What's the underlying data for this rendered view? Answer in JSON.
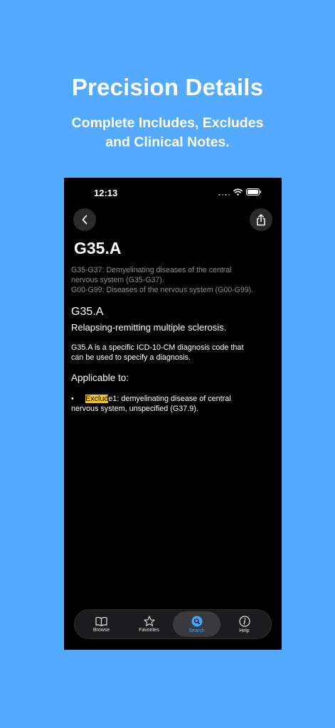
{
  "promo": {
    "title": "Precision Details",
    "subtitle_line1": "Complete Includes, Excludes",
    "subtitle_line2": "and Clinical Notes."
  },
  "status_bar": {
    "time": "12:13"
  },
  "header": {
    "back_icon": "chevron-left-icon",
    "share_icon": "share-icon"
  },
  "code": {
    "title": "G35.A",
    "hierarchy": [
      "G35-G37: Demyelinating diseases of the central",
      "nervous system (G35-G37).",
      "G00-G99: Diseases of the nervous system (G00-G99)."
    ],
    "subtitle": "G35.A",
    "description": "Relapsing-remitting multiple sclerosis.",
    "paragraph_line1": "G35.A is a specific ICD-10-CM diagnosis code that",
    "paragraph_line2": "can be used to specify a diagnosis.",
    "applicable_label": "Applicable to:",
    "bullet": "•",
    "item_highlight": "Exclud",
    "item_rest_line1": "e1:  demyelinating disease of central",
    "item_line2": "nervous system, unspecified (G37.9)."
  },
  "tabs": [
    {
      "label": "Browse",
      "icon": "book-icon"
    },
    {
      "label": "Favorites",
      "icon": "star-icon"
    },
    {
      "label": "Search",
      "icon": "search-icon"
    },
    {
      "label": "Help",
      "icon": "info-icon"
    }
  ],
  "colors": {
    "background": "#54aafe",
    "highlight": "#f8c91a",
    "accent": "#42a6ff"
  }
}
